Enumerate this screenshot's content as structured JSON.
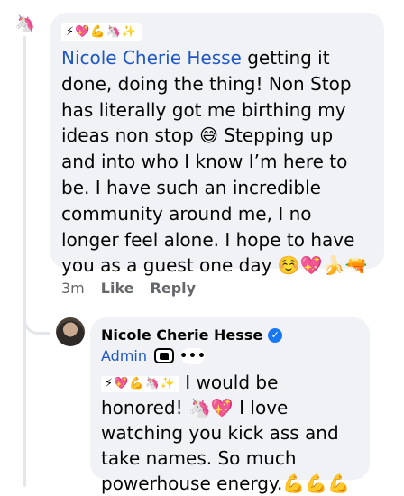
{
  "comment": {
    "avatar_glyph": "🦄",
    "header_emojis": "⚡💖💪🦄✨",
    "mention": "Nicole Cherie Hesse",
    "text": " getting it done, doing the thing! Non Stop has literally got me birthing my ideas non stop 😅 Stepping up and into who I know I’m here to be. I have such an incredible community around me, I no longer feel alone. I hope to have you as a guest one day ☺️💖🍌🔫",
    "time": "3m",
    "like_label": "Like",
    "reply_label": "Reply"
  },
  "reply": {
    "author": "Nicole Cherie Hesse",
    "role": "Admin",
    "more_label": "•••",
    "inline_emojis": "⚡💖💪🦄✨",
    "text": " I would be honored! 🦄💖 I love watching you kick ass and take names. So much powerhouse energy.💪💪💪"
  },
  "colors": {
    "bubble": "#f0f2f5",
    "mention": "#1f57c3",
    "verified": "#1877f2",
    "meta": "#65676b"
  }
}
